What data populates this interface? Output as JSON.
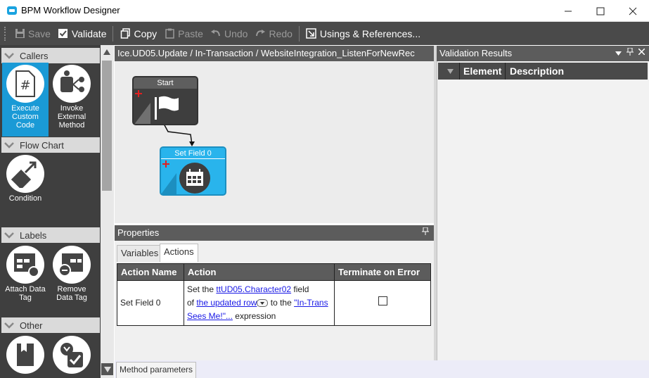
{
  "window": {
    "title": "BPM Workflow Designer"
  },
  "toolbar": {
    "save": "Save",
    "validate": "Validate",
    "copy": "Copy",
    "paste": "Paste",
    "undo": "Undo",
    "redo": "Redo",
    "usings": "Usings & References..."
  },
  "toolbox": {
    "groups": [
      {
        "title": "Callers",
        "items": [
          {
            "label": "Execute Custom Code"
          },
          {
            "label": "Invoke External Method"
          }
        ]
      },
      {
        "title": "Flow Chart",
        "items": [
          {
            "label": "Condition"
          }
        ]
      },
      {
        "title": "Labels",
        "items": [
          {
            "label": "Attach Data Tag"
          },
          {
            "label": "Remove Data Tag"
          }
        ]
      },
      {
        "title": "Other",
        "items": []
      }
    ]
  },
  "designer": {
    "path": "Ice.UD05.Update / In-Transaction / WebsiteIntegration_ListenForNewRec",
    "nodes": [
      {
        "label": "Start"
      },
      {
        "label": "Set Field 0"
      }
    ]
  },
  "properties": {
    "title": "Properties",
    "tabs": [
      "Variables",
      "Actions"
    ],
    "columns": [
      "Action Name",
      "Action",
      "Terminate on Error"
    ],
    "rows": [
      {
        "name": "Set Field 0",
        "prefix": "Set the ",
        "field_link": "ttUD05.Character02",
        "mid1": " field",
        "of": "of ",
        "row_link": "the updated row",
        "mid2": " to the ",
        "expr_link": "\"In-Trans Sees Me!\"...",
        "suffix": " expression"
      }
    ]
  },
  "bottom_tab": "Method parameters",
  "validation": {
    "title": "Validation Results",
    "columns": [
      "Element",
      "Description"
    ]
  },
  "colors": {
    "accent": "#1a9ad6",
    "toolbar": "#4a4a4a",
    "header": "#5c5c5c"
  }
}
